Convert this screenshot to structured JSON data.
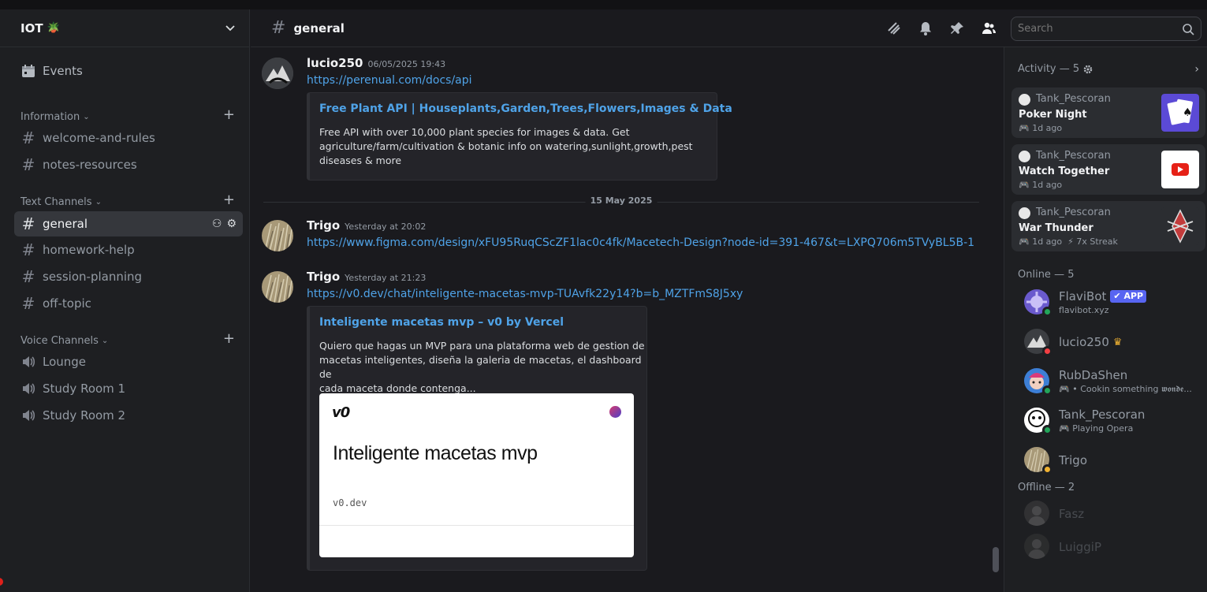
{
  "server": {
    "name": "IOT",
    "emoji": "🪴"
  },
  "sidebar": {
    "events_label": "Events",
    "categories": [
      {
        "label": "Information",
        "channels": [
          "welcome-and-rules",
          "notes-resources"
        ]
      },
      {
        "label": "Text Channels",
        "channels": [
          "general",
          "homework-help",
          "session-planning",
          "off-topic"
        ]
      },
      {
        "label": "Voice Channels",
        "channels": [
          "Lounge",
          "Study Room 1",
          "Study Room 2"
        ]
      }
    ]
  },
  "header": {
    "channel": "general",
    "search_placeholder": "Search"
  },
  "messages": [
    {
      "author": "lucio250",
      "time": "06/05/2025 19:43",
      "link": "https://perenual.com/docs/api",
      "embed": {
        "title": "Free Plant API | Houseplants,Garden,Trees,Flowers,Images & Data",
        "desc1": "Free API with over 10,000 plant species for images & data. Get",
        "desc2": "agriculture/farm/cultivation & botanic info on watering,sunlight,growth,pest",
        "desc3": "diseases & more"
      }
    },
    {
      "date_divider": "15 May 2025"
    },
    {
      "author": "Trigo",
      "time": "Yesterday at 20:02",
      "link": "https://www.figma.com/design/xFU95RuqCScZF1lac0c4fk/Macetech-Design?node-id=391-467&t=LXPQ706m5TVyBL5B-1"
    },
    {
      "author": "Trigo",
      "time": "Yesterday at 21:23",
      "link": "https://v0.dev/chat/inteligente-macetas-mvp-TUAvfk22y14?b=b_MZTFmS8J5xy",
      "embed": {
        "title": "Inteligente macetas mvp – v0 by Vercel",
        "desc1": "Quiero que hagas un MVP para una plataforma web de gestion de",
        "desc2": "macetas inteligentes, diseña la galeria de macetas, el dashboard de",
        "desc3": "cada maceta donde contenga...",
        "preview_logo": "v0",
        "preview_title": "Inteligente macetas mvp",
        "preview_domain": "v0.dev"
      }
    }
  ],
  "activity": {
    "header": "Activity — 5",
    "cards": [
      {
        "user": "Tank_Pescoran",
        "activity": "Poker Night",
        "ago": "1d ago",
        "extra": ""
      },
      {
        "user": "Tank_Pescoran",
        "activity": "Watch Together",
        "ago": "1d ago",
        "extra": ""
      },
      {
        "user": "Tank_Pescoran",
        "activity": "War Thunder",
        "ago": "1d ago",
        "extra": "7x Streak"
      }
    ]
  },
  "online": {
    "header": "Online — 5",
    "members": [
      {
        "name": "FlaviBot",
        "badge": "APP",
        "sub": "flavibot.xyz"
      },
      {
        "name": "lucio250",
        "sub": ""
      },
      {
        "name": "RubDaShen",
        "sub": "• Cookin something 𝖜𝖔𝖓𝖉𝖊..."
      },
      {
        "name": "Tank_Pescoran",
        "sub": "Playing Opera"
      },
      {
        "name": "Trigo",
        "sub": ""
      }
    ]
  },
  "offline": {
    "header": "Offline — 2",
    "members": [
      {
        "name": "Fasz"
      },
      {
        "name": "LuiggiP"
      }
    ]
  },
  "colors": {
    "link": "#4fa3e8",
    "online": "#23a55a",
    "dnd": "#f23f43",
    "idle": "#f0b232",
    "app_badge": "#5865f2"
  }
}
